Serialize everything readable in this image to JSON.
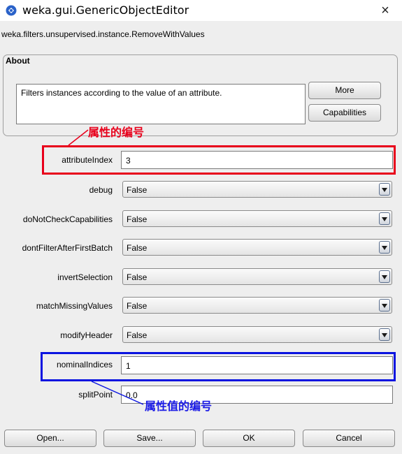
{
  "window": {
    "title": "weka.gui.GenericObjectEditor",
    "close_label": "×"
  },
  "classname": "weka.filters.unsupervised.instance.RemoveWithValues",
  "about": {
    "label": "About",
    "text": "Filters instances according to the value of an attribute.",
    "more_label": "More",
    "capabilities_label": "Capabilities"
  },
  "properties": {
    "attributeIndex": {
      "label": "attributeIndex",
      "value": "3"
    },
    "debug": {
      "label": "debug",
      "value": "False"
    },
    "doNotCheckCapabilities": {
      "label": "doNotCheckCapabilities",
      "value": "False"
    },
    "dontFilterAfterFirstBatch": {
      "label": "dontFilterAfterFirstBatch",
      "value": "False"
    },
    "invertSelection": {
      "label": "invertSelection",
      "value": "False"
    },
    "matchMissingValues": {
      "label": "matchMissingValues",
      "value": "False"
    },
    "modifyHeader": {
      "label": "modifyHeader",
      "value": "False"
    },
    "nominalIndices": {
      "label": "nominalIndices",
      "value": "1"
    },
    "splitPoint": {
      "label": "splitPoint",
      "value": "0.0"
    }
  },
  "annotations": {
    "attribute_note": "属性的编号",
    "nominal_note": "属性值的编号",
    "red_color": "#e8001b",
    "blue_color": "#0a14e0"
  },
  "footer": {
    "open_label": "Open...",
    "save_label": "Save...",
    "ok_label": "OK",
    "cancel_label": "Cancel"
  }
}
